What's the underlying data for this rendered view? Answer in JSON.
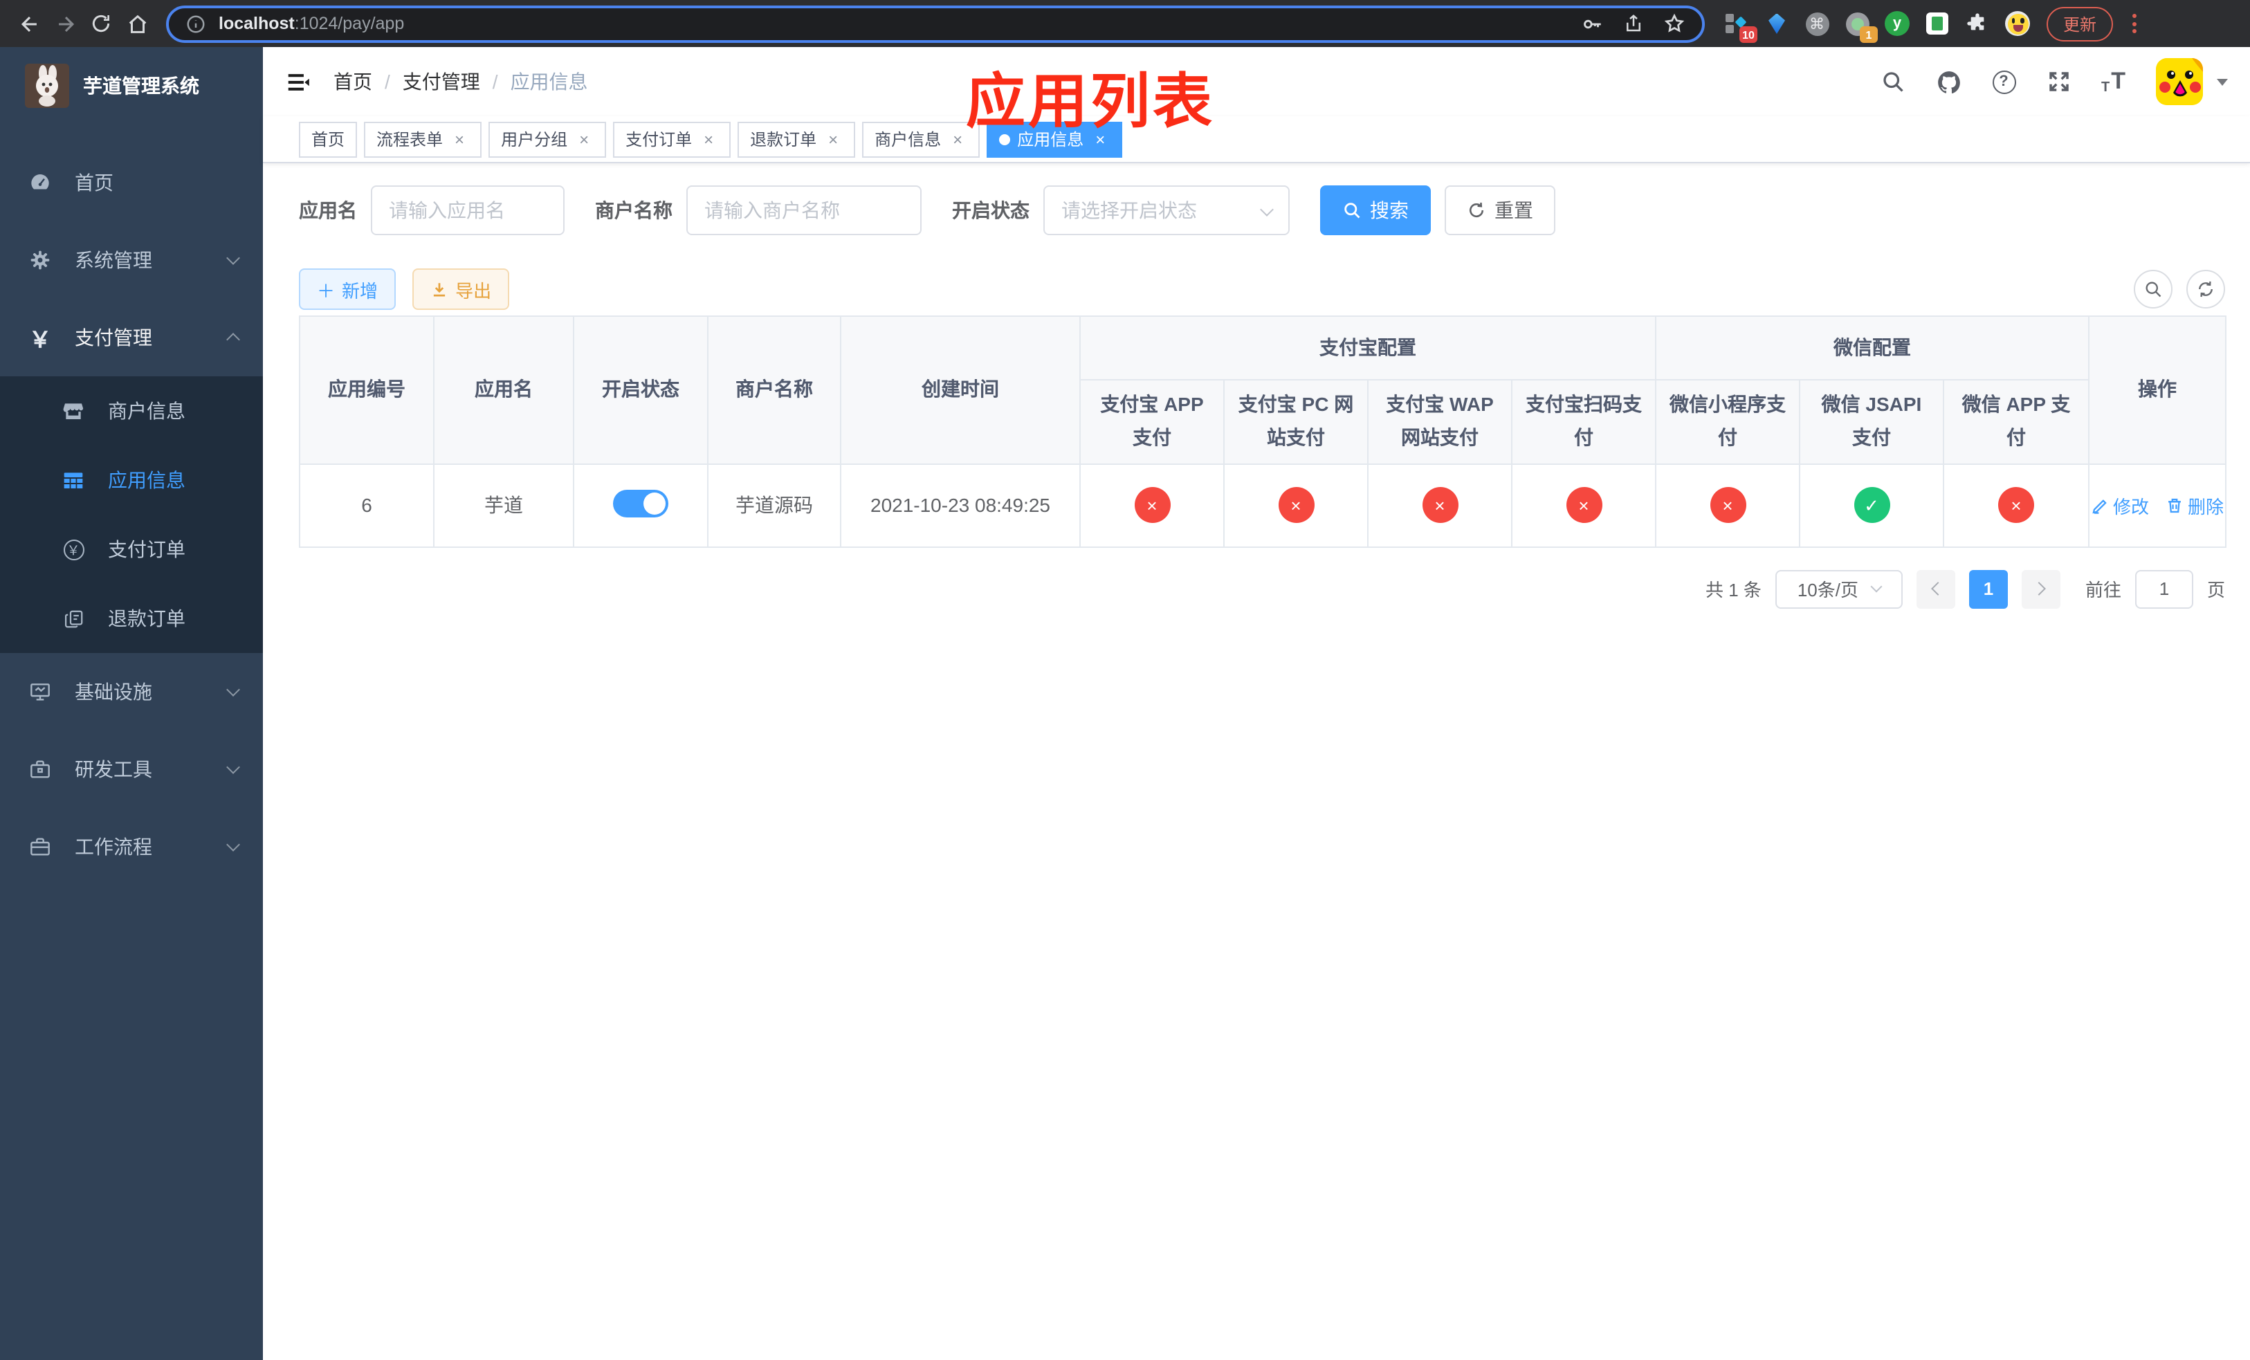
{
  "colors": {
    "accent": "#409eff",
    "danger_circle": "#f5483f",
    "success_circle": "#1dc779",
    "warning": "#e6a23c",
    "sidebar_bg": "#304156",
    "submenu_bg": "#1f2d3d",
    "annotation_red": "#fa2c16",
    "active_tab_bg": "#409eff"
  },
  "icons": {
    "gear": "⚙",
    "yen": "￥",
    "plus": "＋",
    "close": "×",
    "check": "✓",
    "cross": "×",
    "question": "?",
    "command": "⌘",
    "ext_y": "y",
    "font_size_small": "T",
    "font_size_big": "T"
  },
  "browser": {
    "url_host": "localhost",
    "url_path": ":1024/pay/app",
    "update_button": "更新",
    "ext_badge_a": "10",
    "ext_badge_b": "1"
  },
  "sidebar": {
    "title": "芋道管理系统",
    "menu": [
      {
        "label": "首页"
      },
      {
        "label": "系统管理"
      },
      {
        "label": "支付管理"
      },
      {
        "label": "基础设施"
      },
      {
        "label": "研发工具"
      },
      {
        "label": "工作流程"
      }
    ],
    "payment_submenu": [
      {
        "label": "商户信息"
      },
      {
        "label": "应用信息"
      },
      {
        "label": "支付订单"
      },
      {
        "label": "退款订单"
      }
    ]
  },
  "header": {
    "breadcrumb": [
      "首页",
      "支付管理",
      "应用信息"
    ],
    "annotation": "应用列表"
  },
  "tabs": [
    {
      "label": "首页"
    },
    {
      "label": "流程表单"
    },
    {
      "label": "用户分组"
    },
    {
      "label": "支付订单"
    },
    {
      "label": "退款订单"
    },
    {
      "label": "商户信息"
    },
    {
      "label": "应用信息"
    }
  ],
  "filters": {
    "app_name_label": "应用名",
    "app_name_placeholder": "请输入应用名",
    "merchant_label": "商户名称",
    "merchant_placeholder": "请输入商户名称",
    "status_label": "开启状态",
    "status_placeholder": "请选择开启状态",
    "search_button": "搜索",
    "reset_button": "重置"
  },
  "toolbar": {
    "add_button": "新增",
    "export_button": "导出"
  },
  "table": {
    "groups": [
      {
        "label": "支付宝配置",
        "span": 4
      },
      {
        "label": "微信配置",
        "span": 3
      }
    ],
    "columns": [
      "应用编号",
      "应用名",
      "开启状态",
      "商户名称",
      "创建时间",
      "支付宝 APP 支付",
      "支付宝 PC 网站支付",
      "支付宝 WAP 网站支付",
      "支付宝扫码支付",
      "微信小程序支付",
      "微信 JSAPI 支付",
      "微信 APP 支付",
      "操作"
    ],
    "rows": [
      {
        "id": "6",
        "name": "芋道",
        "enabled": true,
        "merchant": "芋道源码",
        "created_at": "2021-10-23 08:49:25",
        "channels": [
          false,
          false,
          false,
          false,
          false,
          true,
          false
        ],
        "edit_label": "修改",
        "delete_label": "删除"
      }
    ]
  },
  "pagination": {
    "total_text": "共 1 条",
    "page_size": "10条/页",
    "page": "1",
    "goto_prefix": "前往",
    "goto_value": "1",
    "goto_suffix": "页"
  }
}
